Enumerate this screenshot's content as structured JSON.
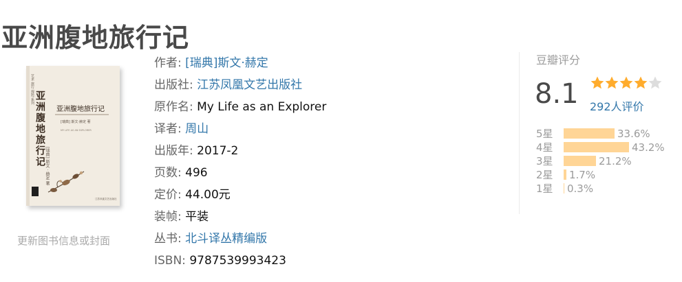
{
  "page": {
    "title": "亚洲腹地旅行记"
  },
  "cover": {
    "series": "艺术 旅行 探险 系列",
    "title": "亚洲腹地旅行记",
    "author": "[瑞典] 斯文·赫定 著",
    "author_vertical": "[瑞典] 斯文 · 赫定 著",
    "english_title": "MY LIFE AS AN EXPLORER",
    "publisher": "江苏凤凰文艺出版社",
    "update_link": "更新图书信息或封面"
  },
  "info": [
    {
      "label": "作者:",
      "value": "[瑞典]斯文·赫定",
      "link": true
    },
    {
      "label": "出版社:",
      "value": "江苏凤凰文艺出版社",
      "link": true
    },
    {
      "label": "原作名:",
      "value": "My Life as an Explorer",
      "link": false
    },
    {
      "label": "译者:",
      "value": "周山",
      "link": true
    },
    {
      "label": "出版年:",
      "value": "2017-2",
      "link": false
    },
    {
      "label": "页数:",
      "value": "496",
      "link": false
    },
    {
      "label": "定价:",
      "value": "44.00元",
      "link": false
    },
    {
      "label": "装帧:",
      "value": "平装",
      "link": false
    },
    {
      "label": "丛书:",
      "value": "北斗译丛精编版",
      "link": true
    },
    {
      "label": "ISBN:",
      "value": "9787539993423",
      "link": false
    }
  ],
  "rating": {
    "label": "豆瓣评分",
    "score": "8.1",
    "stars": 4,
    "votes": "292人评价",
    "distribution": [
      {
        "label": "5星",
        "percent": "33.6%",
        "value": 33.6
      },
      {
        "label": "4星",
        "percent": "43.2%",
        "value": 43.2
      },
      {
        "label": "3星",
        "percent": "21.2%",
        "value": 21.2
      },
      {
        "label": "2星",
        "percent": "1.7%",
        "value": 1.7
      },
      {
        "label": "1星",
        "percent": "0.3%",
        "value": 0.3
      }
    ]
  },
  "colors": {
    "link": "#3377aa",
    "star_filled": "#ffac2d",
    "star_empty": "#dddddd",
    "bar": "#ffd596",
    "muted": "#9b9b9b"
  }
}
